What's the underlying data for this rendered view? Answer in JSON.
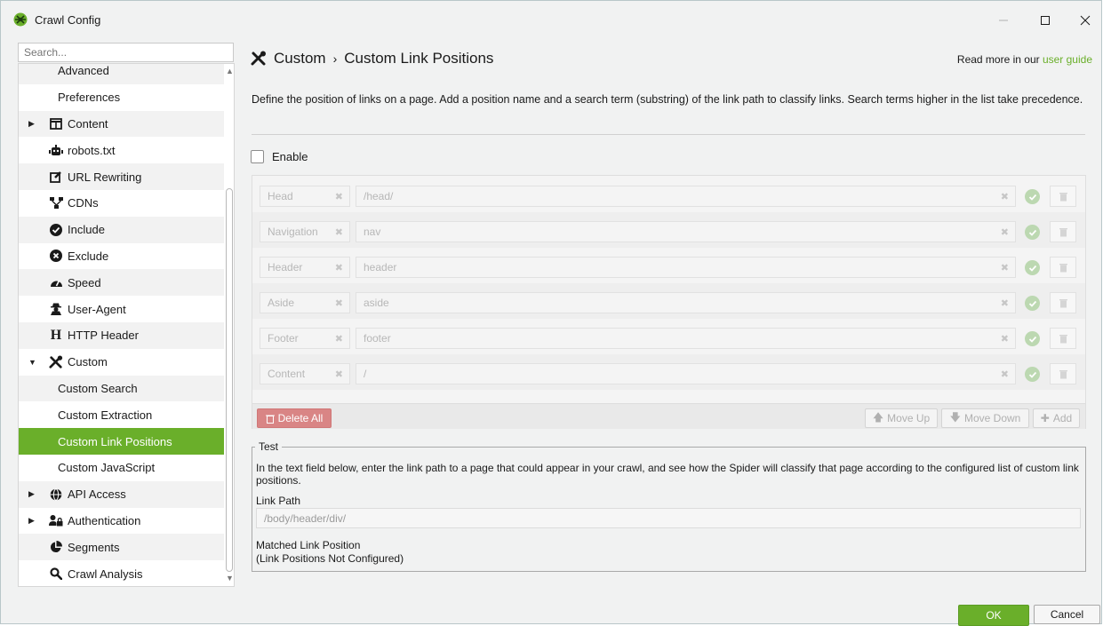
{
  "window": {
    "title": "Crawl Config",
    "minimize": "—",
    "maximize": "☐",
    "close": "✕"
  },
  "sidebar": {
    "search_placeholder": "Search...",
    "items": [
      {
        "label": "Advanced",
        "icon": "none",
        "sub": true
      },
      {
        "label": "Preferences",
        "icon": "none",
        "sub": true
      },
      {
        "label": "Content",
        "icon": "columns-icon",
        "arrow": "▶"
      },
      {
        "label": "robots.txt",
        "icon": "robot-icon"
      },
      {
        "label": "URL Rewriting",
        "icon": "edit-icon"
      },
      {
        "label": "CDNs",
        "icon": "network-icon"
      },
      {
        "label": "Include",
        "icon": "check-circle-icon"
      },
      {
        "label": "Exclude",
        "icon": "x-circle-icon"
      },
      {
        "label": "Speed",
        "icon": "gauge-icon"
      },
      {
        "label": "User-Agent",
        "icon": "user-secret-icon"
      },
      {
        "label": "HTTP Header",
        "icon": "h-icon"
      },
      {
        "label": "Custom",
        "icon": "tools-icon",
        "arrow": "▼"
      },
      {
        "label": "Custom Search",
        "sub": true
      },
      {
        "label": "Custom Extraction",
        "sub": true
      },
      {
        "label": "Custom Link Positions",
        "sub": true,
        "active": true
      },
      {
        "label": "Custom JavaScript",
        "sub": true
      },
      {
        "label": "API Access",
        "icon": "globe-icon",
        "arrow": "▶"
      },
      {
        "label": "Authentication",
        "icon": "user-lock-icon",
        "arrow": "▶"
      },
      {
        "label": "Segments",
        "icon": "pie-chart-icon"
      },
      {
        "label": "Crawl Analysis",
        "icon": "search-icon"
      }
    ]
  },
  "header": {
    "section": "Custom",
    "separator": "›",
    "page": "Custom Link Positions",
    "readmore_prefix": "Read more in our ",
    "readmore_link": "user guide"
  },
  "description": "Define the position of links on a page. Add a position name and a search term (substring) of the link path to classify links. Search terms higher in the list take precedence.",
  "enable_label": "Enable",
  "positions": [
    {
      "name": "Head",
      "term": "/head/"
    },
    {
      "name": "Navigation",
      "term": "nav"
    },
    {
      "name": "Header",
      "term": "header"
    },
    {
      "name": "Aside",
      "term": "aside"
    },
    {
      "name": "Footer",
      "term": "footer"
    },
    {
      "name": "Content",
      "term": "/"
    }
  ],
  "buttons": {
    "delete_all": "Delete All",
    "move_up": "Move Up",
    "move_down": "Move Down",
    "add": "Add",
    "ok": "OK",
    "cancel": "Cancel"
  },
  "test": {
    "legend": "Test",
    "description": "In the text field below, enter the link path to a page that could appear in your crawl, and see how the Spider will classify that page according to the configured list of custom link positions.",
    "link_path_label": "Link Path",
    "link_path_placeholder": "/body/header/div/",
    "matched_label": "Matched Link Position",
    "matched_value": "(Link Positions Not Configured)"
  },
  "colors": {
    "accent": "#6aaf2a",
    "danger": "#d98585"
  }
}
